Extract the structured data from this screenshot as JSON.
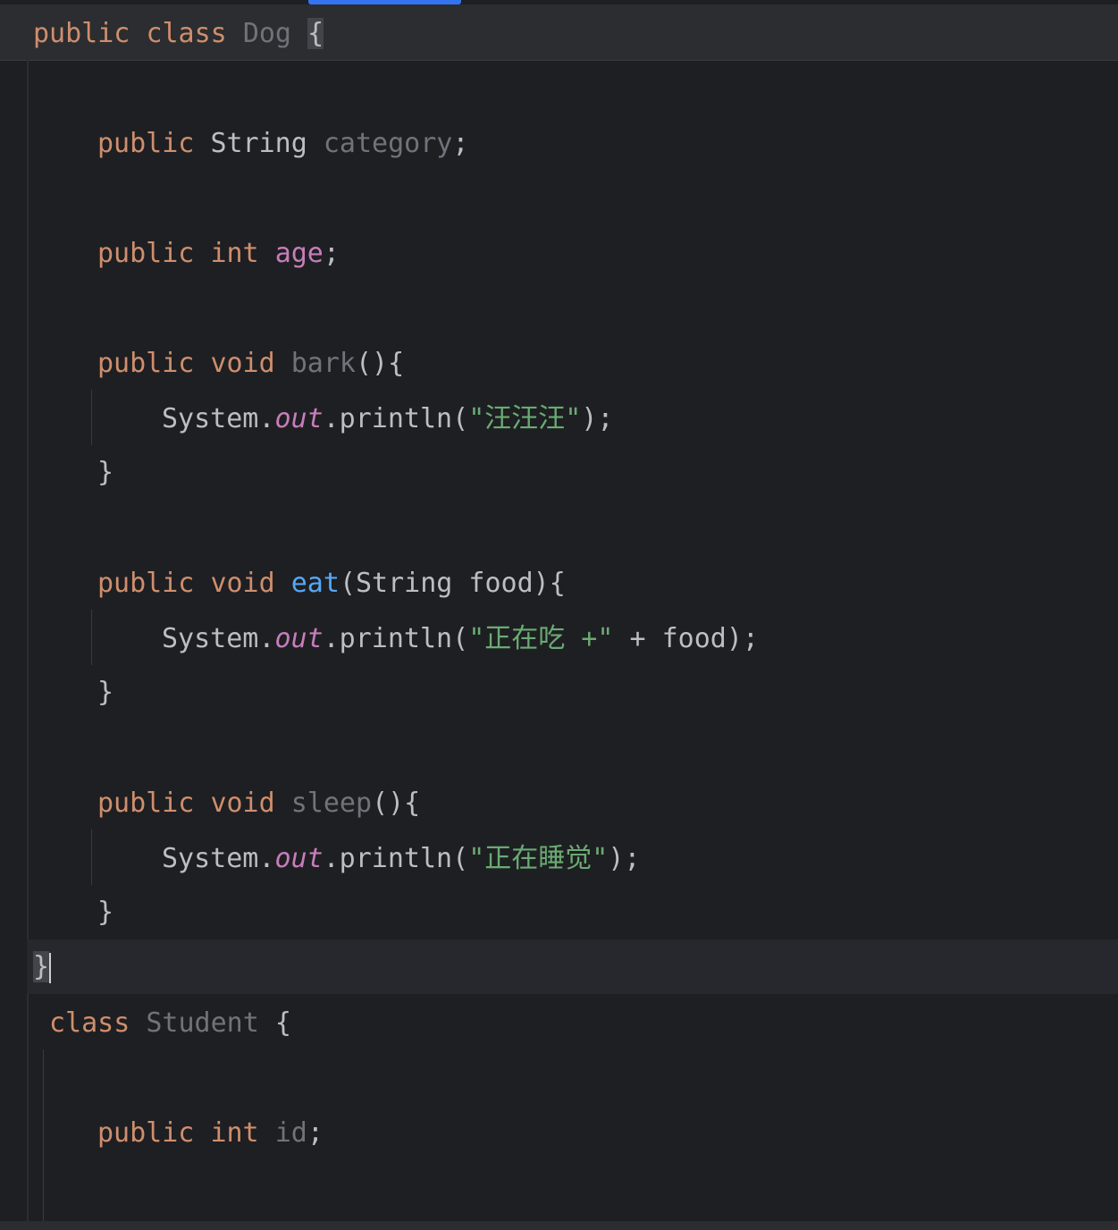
{
  "header": {
    "kw_public": "public",
    "kw_class": "class",
    "class_name": "Dog",
    "open_brace": "{"
  },
  "code": {
    "l1_public": "public",
    "l1_type": "String",
    "l1_name": "category",
    "l1_semi": ";",
    "l2_public": "public",
    "l2_type": "int",
    "l2_name": "age",
    "l2_semi": ";",
    "bark_public": "public",
    "bark_void": "void",
    "bark_name": "bark",
    "bark_rest": "(){",
    "bark_sys": "System.",
    "bark_out": "out",
    "bark_println": ".println(",
    "bark_str": "\"汪汪汪\"",
    "bark_end": ");",
    "bark_close": "}",
    "eat_public": "public",
    "eat_void": "void",
    "eat_name": "eat",
    "eat_params": "(String food){",
    "eat_sys": "System.",
    "eat_out": "out",
    "eat_println": ".println(",
    "eat_str": "\"正在吃 +\"",
    "eat_end": " + food);",
    "eat_close": "}",
    "sleep_public": "public",
    "sleep_void": "void",
    "sleep_name": "sleep",
    "sleep_rest": "(){",
    "sleep_sys": "System.",
    "sleep_out": "out",
    "sleep_println": ".println(",
    "sleep_str": "\"正在睡觉\"",
    "sleep_end": ");",
    "sleep_close": "}",
    "class_close": "}",
    "student_kw": "class",
    "student_name": "Student",
    "student_brace": "{",
    "id_public": "public",
    "id_type": "int",
    "id_name": "id",
    "id_semi": ";"
  },
  "colors": {
    "keyword": "#cf8e6d",
    "string": "#6aab73",
    "field": "#c77dbb",
    "method_decl": "#56a8f5",
    "unused": "#6f737a",
    "default_text": "#bcbec4",
    "background": "#1e1f22",
    "accent": "#3574f0"
  }
}
